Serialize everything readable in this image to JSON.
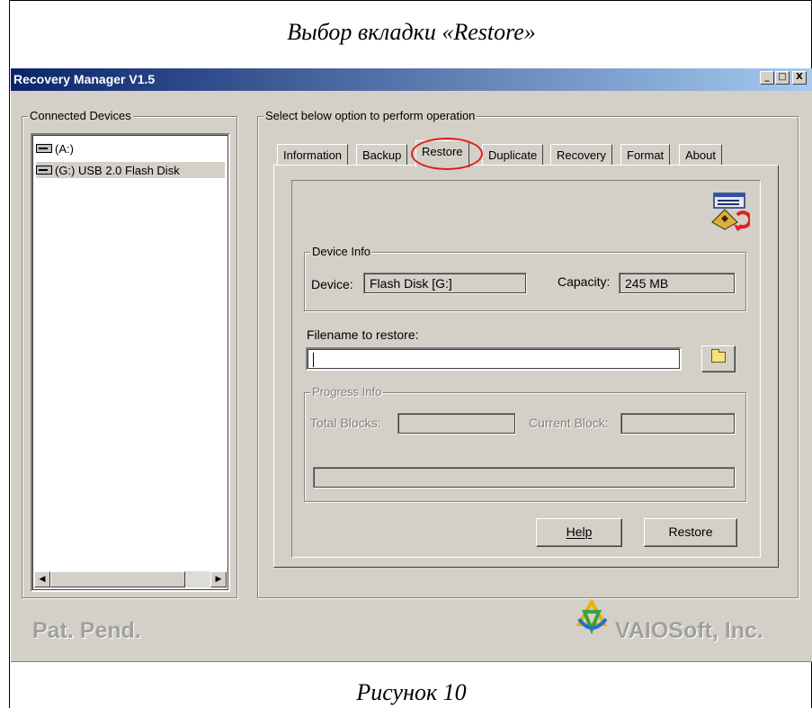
{
  "document": {
    "heading": "Выбор вкладки «Restore»",
    "caption": "Рисунок 10"
  },
  "window": {
    "title": "Recovery Manager V1.5",
    "controls": {
      "minimize": "_",
      "maximize": "□",
      "close": "X"
    }
  },
  "devices_panel": {
    "label": "Connected Devices",
    "items": [
      {
        "icon": "drive-icon",
        "label": "(A:)"
      },
      {
        "icon": "drive-icon",
        "label": "(G:) USB 2.0  Flash Disk",
        "selected": true
      }
    ]
  },
  "operations_panel": {
    "label": "Select below option to perform operation",
    "tabs": [
      {
        "label": "Information"
      },
      {
        "label": "Backup"
      },
      {
        "label": "Restore",
        "active": true
      },
      {
        "label": "Duplicate"
      },
      {
        "label": "Recovery"
      },
      {
        "label": "Format"
      },
      {
        "label": "About"
      }
    ]
  },
  "device_info": {
    "label": "Device Info",
    "device_label": "Device:",
    "device_value": "Flash Disk      [G:]",
    "capacity_label": "Capacity:",
    "capacity_value": "245 MB"
  },
  "restore": {
    "filename_label": "Filename to restore:",
    "filename_value": ""
  },
  "progress_info": {
    "label": "Progress Info",
    "total_blocks_label": "Total Blocks:",
    "total_blocks_value": "",
    "current_block_label": "Current Block:",
    "current_block_value": "",
    "progress": 0
  },
  "buttons": {
    "help": "Help",
    "restore": "Restore"
  },
  "footer": {
    "left": "Pat. Pend.",
    "right": "VAIOSoft, Inc."
  },
  "colors": {
    "window_bg": "#d4d0c8",
    "titlebar_start": "#0a246a",
    "titlebar_end": "#a6caf0",
    "highlight_circle": "#e21b1b",
    "footer_text": "#a0a0a0"
  }
}
